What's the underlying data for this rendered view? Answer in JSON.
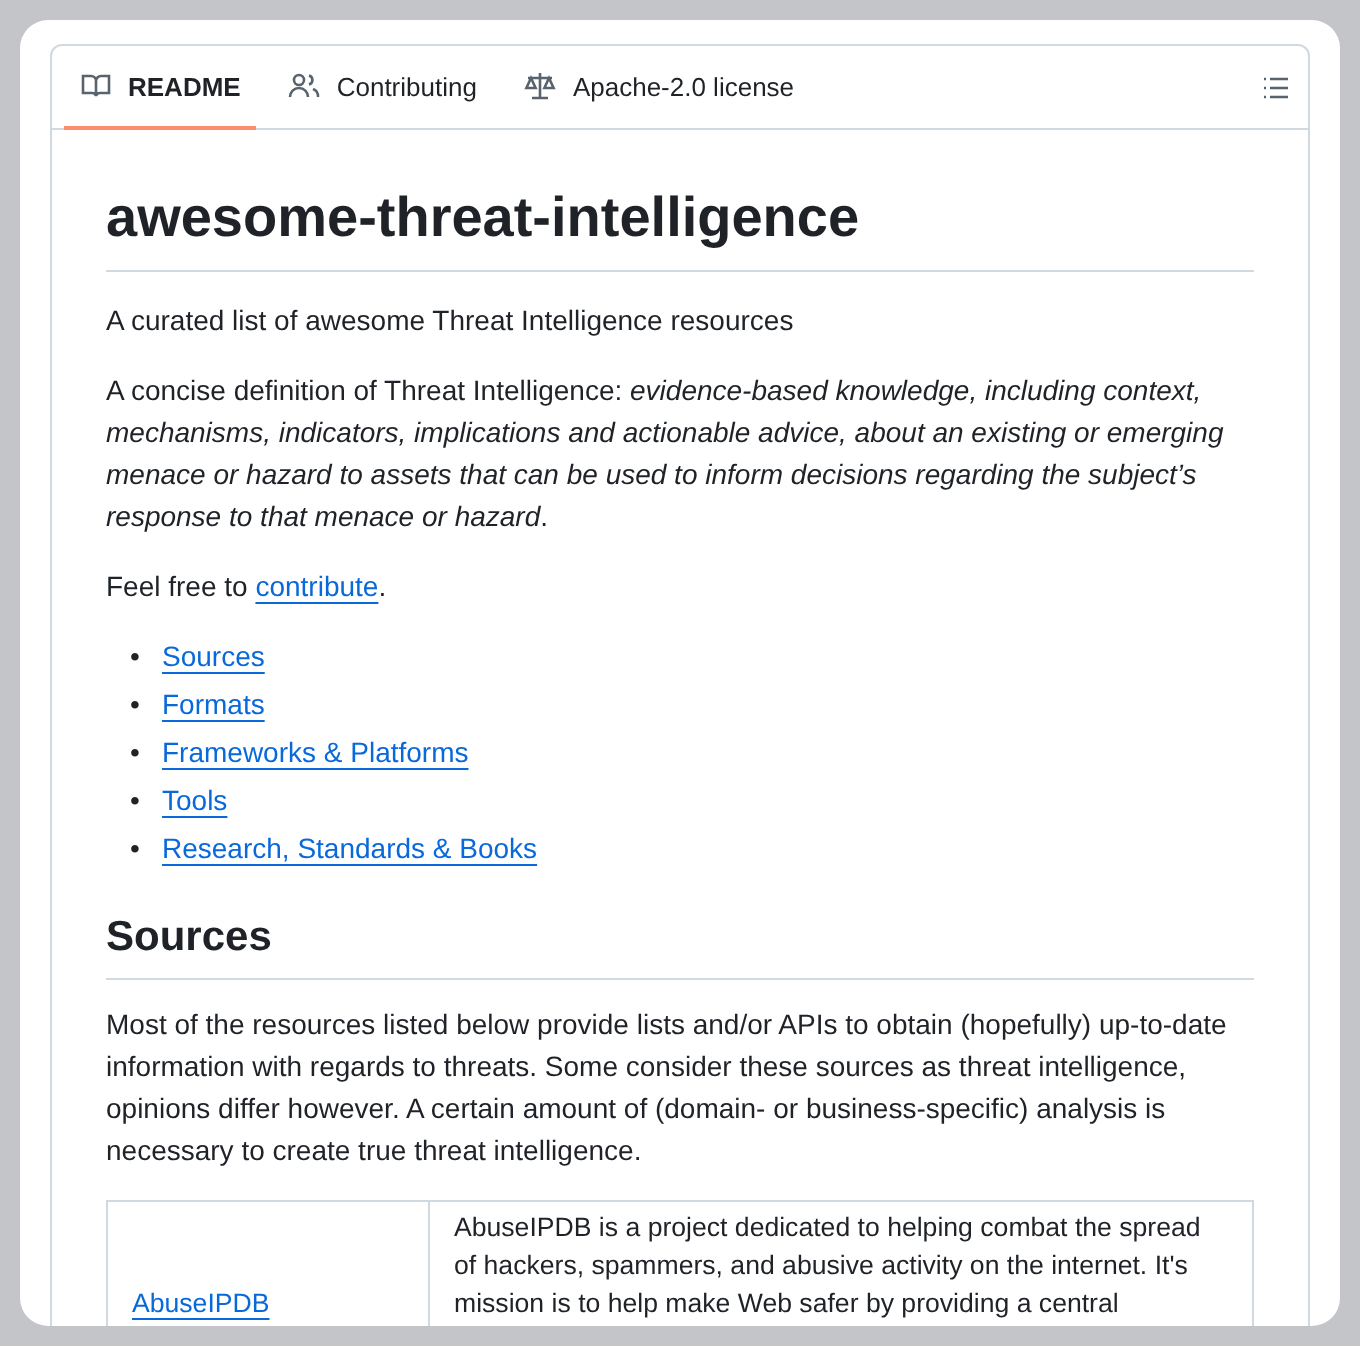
{
  "tabs": [
    {
      "label": "README",
      "kind": "book",
      "selected": true
    },
    {
      "label": "Contributing",
      "kind": "people",
      "selected": false
    },
    {
      "label": "Apache-2.0 license",
      "kind": "scale",
      "selected": false
    }
  ],
  "readme": {
    "title": "awesome-threat-intelligence",
    "intro": "A curated list of awesome Threat Intelligence resources",
    "definition": "A concise definition of Threat Intelligence: *evidence-based knowledge, including context, mechanisms, indicators, implications and actionable advice, about an existing or emerging menace or hazard to assets that can be used to inform decisions regarding the subject’s response to that menace or hazard*.",
    "contribute": {
      "before": "Feel free to",
      "link": "contribute",
      "after": "."
    },
    "contents": [
      {
        "marker": "•",
        "label": "Sources"
      },
      {
        "marker": "•",
        "label": "Formats"
      },
      {
        "marker": "•",
        "label": "Frameworks & Platforms"
      },
      {
        "marker": "•",
        "label": "Tools"
      },
      {
        "marker": "•",
        "label": "Research, Standards & Books"
      }
    ],
    "section": {
      "heading": "Sources",
      "text": "Most of the resources listed below provide lists and/or APIs to obtain (hopefully) up-to-date information with regards to threats. Some consider these sources as threat intelligence, opinions differ however. A certain amount of (domain- or business-specific) analysis is necessary to create true threat intelligence.",
      "table": {
        "rows": [
          {
            "name": "AbuseIPDB",
            "description": "AbuseIPDB is a project dedicated to helping combat the spread of hackers, spammers, and abusive activity on the internet. It's mission is to help make Web safer by providing a central"
          }
        ]
      }
    }
  }
}
